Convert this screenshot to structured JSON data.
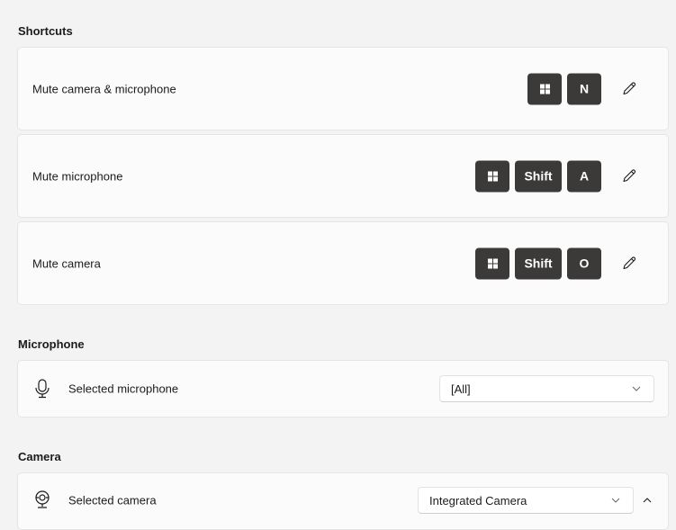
{
  "shortcuts": {
    "title": "Shortcuts",
    "items": [
      {
        "label": "Mute camera & microphone",
        "keys": [
          "win",
          "N"
        ]
      },
      {
        "label": "Mute microphone",
        "keys": [
          "win",
          "Shift",
          "A"
        ]
      },
      {
        "label": "Mute camera",
        "keys": [
          "win",
          "Shift",
          "O"
        ]
      }
    ],
    "edit_icon": "pencil-icon"
  },
  "microphone": {
    "title": "Microphone",
    "label": "Selected microphone",
    "icon": "microphone-icon",
    "selected": "[All]"
  },
  "camera": {
    "title": "Camera",
    "label": "Selected camera",
    "icon": "webcam-icon",
    "selected": "Integrated Camera",
    "expanded": true
  }
}
